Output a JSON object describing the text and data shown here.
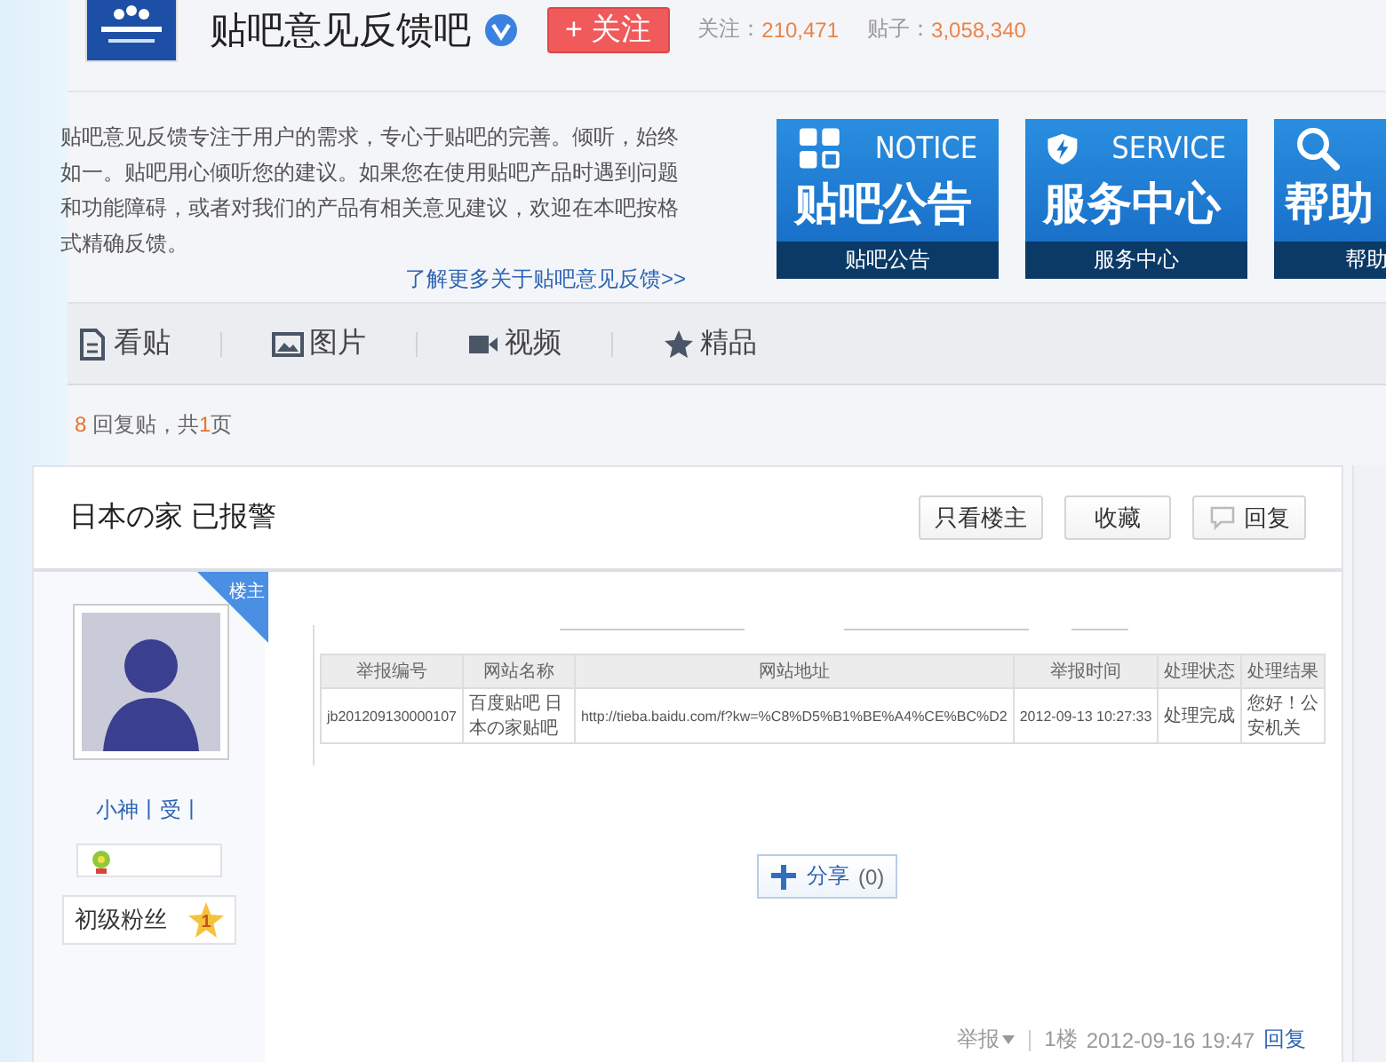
{
  "forum": {
    "name": "贴吧意见反馈吧",
    "verified": true,
    "follow_button": "+ 关注",
    "stats": [
      {
        "label": "关注：",
        "value": "210,471"
      },
      {
        "label": "贴子：",
        "value": "3,058,340"
      }
    ]
  },
  "intro": {
    "text": "贴吧意见反馈专注于用户的需求，专心于贴吧的完善。倾听，始终如一。贴吧用心倾听您的建议。如果您在使用贴吧产品时遇到问题和功能障碍，或者对我们的产品有相关意见建议，欢迎在本吧按格式精确反馈。",
    "link": "了解更多关于贴吧意见反馈>>"
  },
  "banners": [
    {
      "kind": "notice",
      "english": "NOTICE",
      "title": "贴吧公告",
      "caption": "贴吧公告"
    },
    {
      "kind": "service",
      "english": "SERVICE",
      "title": "服务中心",
      "caption": "服务中心"
    },
    {
      "kind": "help",
      "title": "帮助",
      "caption": "帮助"
    }
  ],
  "tabs": [
    {
      "kind": "posts",
      "label": "看贴"
    },
    {
      "kind": "images",
      "label": "图片"
    },
    {
      "kind": "videos",
      "label": "视频"
    },
    {
      "kind": "featured",
      "label": "精品"
    }
  ],
  "reply_summary": {
    "count": "8",
    "middle": " 回复贴，共",
    "pages": "1",
    "end": "页"
  },
  "thread": {
    "title": "日本の家 已报警",
    "buttons": [
      {
        "kind": "plain",
        "label": "只看楼主"
      },
      {
        "kind": "plain",
        "label": "收藏"
      },
      {
        "kind": "reply",
        "label": "回复"
      }
    ]
  },
  "post": {
    "badge": "楼主",
    "author": "小神丨受丨",
    "fan_level": "初级粉丝",
    "fan_rank": "1",
    "screenshot": {
      "columns": [
        "举报编号",
        "网站名称",
        "网站地址",
        "举报时间",
        "处理状态",
        "处理结果"
      ],
      "rows": [
        [
          "jb201209130000107",
          "百度贴吧 日本の家贴吧",
          "http://tieba.baidu.com/f?kw=%C8%D5%B1%BE%A4%CE%BC%D2",
          "2012-09-13 10:27:33",
          "处理完成",
          "您好！公安机关"
        ]
      ]
    },
    "share": "分享",
    "share_count": "(0)",
    "report": "举报",
    "floor": "1楼",
    "time": "2012-09-16 19:47",
    "reply": "回复"
  }
}
